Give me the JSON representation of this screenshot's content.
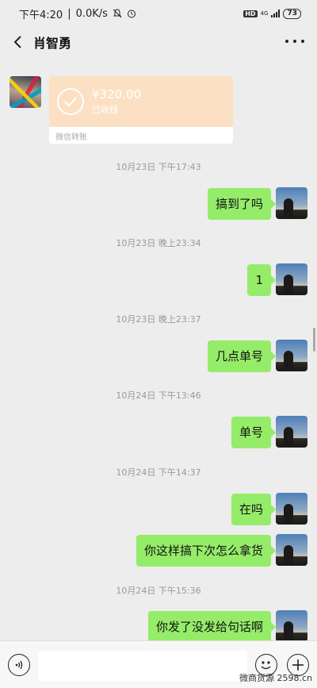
{
  "status_bar": {
    "time": "下午4:20",
    "network_speed": "0.0K/s",
    "hd": "HD",
    "net_type": "4G",
    "battery": "73"
  },
  "header": {
    "title": "肖智勇"
  },
  "transfer": {
    "amount": "¥320.00",
    "status": "已收钱",
    "footer": "微信转账"
  },
  "messages": [
    {
      "time": "10月23日 下午17:43",
      "text": "搞到了吗"
    },
    {
      "time": "10月23日 晚上23:34",
      "text": "1"
    },
    {
      "time": "10月23日 晚上23:37",
      "text": "几点单号"
    },
    {
      "time": "10月24日 下午13:46",
      "text": "单号"
    },
    {
      "time": "10月24日 下午14:37",
      "text": "在吗"
    },
    {
      "time": "",
      "text": "你这样搞下次怎么拿货"
    },
    {
      "time": "10月24日 下午15:36",
      "text": "你发了没发给句话啊"
    }
  ],
  "input": {
    "placeholder": ""
  },
  "watermark": "微商货源 2598.cn",
  "colors": {
    "bubble": "#95ec69",
    "background": "#ededed",
    "transfer": "#fce0c4"
  }
}
